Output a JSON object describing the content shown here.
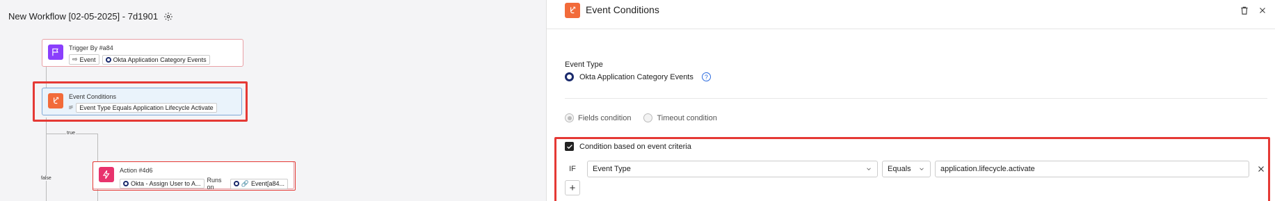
{
  "workflow": {
    "title": "New Workflow [02-05-2025] - 7d1901"
  },
  "nodes": {
    "trigger": {
      "title": "Trigger By #a84",
      "chip_event": "Event",
      "chip_app": "Okta Application Category Events",
      "icon": "flag-icon",
      "color": "#8a3ffc"
    },
    "conditions": {
      "title": "Event Conditions",
      "if_tag": "IF",
      "chip_condition": "Event Type Equals Application Lifecycle Activate",
      "icon": "branch-icon",
      "color": "#f26b3a"
    },
    "action": {
      "title": "Action #4d6",
      "chip_action": "Okta - Assign User to A...",
      "runs_on": "Runs on",
      "chip_event": "Event[a84...",
      "icon": "bolt-icon",
      "color": "#e8336d"
    }
  },
  "edges": {
    "true_label": "true",
    "false_label": "false"
  },
  "panel": {
    "title": "Event Conditions",
    "event_type_label": "Event Type",
    "event_type_value": "Okta Application Category Events",
    "help_icon": "?",
    "radio_fields": "Fields condition",
    "radio_timeout": "Timeout condition",
    "checkbox_label": "Condition based on event criteria",
    "condition": {
      "if_label": "IF",
      "field": "Event Type",
      "operator": "Equals",
      "value": "application.lifecycle.activate"
    },
    "add_label": "+"
  },
  "colors": {
    "highlight": "#e53935",
    "accent_ring": "#1a2a6c"
  }
}
